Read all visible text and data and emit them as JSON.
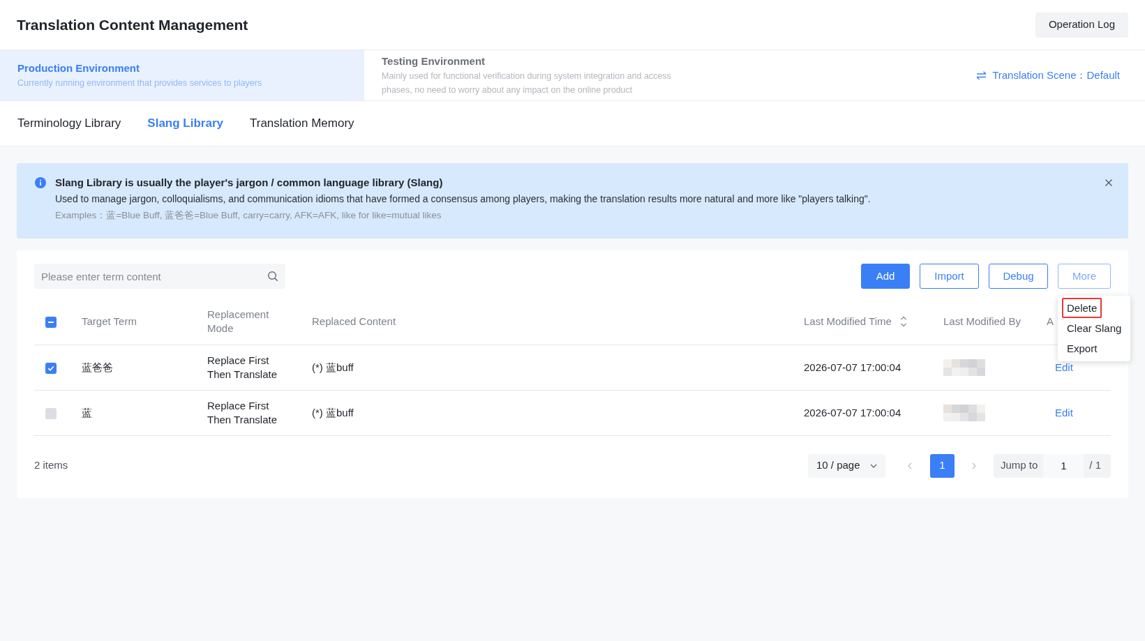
{
  "header": {
    "title": "Translation Content Management",
    "action_button": "Operation Log"
  },
  "environments": [
    {
      "title": "Production Environment",
      "description": "Currently running environment that provides services to players",
      "selected": true
    },
    {
      "title": "Testing Environment",
      "description": "Mainly used for functional verification during system integration and access phases, no need to worry about any impact on the online product",
      "selected": false
    }
  ],
  "translation_scene": "Translation Scene：Default",
  "tabs": [
    {
      "label": "Terminology Library",
      "selected": false
    },
    {
      "label": "Slang Library",
      "selected": true
    },
    {
      "label": "Translation Memory",
      "selected": false
    }
  ],
  "notice": {
    "title": "Slang Library is usually the player's jargon / common language library (Slang)",
    "body": "Used to manage jargon, colloquialisms, and communication idioms that have formed a consensus among players, making the translation results more natural and more like \"players talking\".",
    "examples": "Examples：蓝=Blue Buff, 蓝爸爸=Blue Buff, carry=carry, AFK=AFK, like for like=mutual likes"
  },
  "toolbar": {
    "search": {
      "placeholder": "Please enter term content"
    },
    "buttons": [
      {
        "label": "Add",
        "kind": "primary"
      },
      {
        "label": "Import",
        "kind": "outline"
      },
      {
        "label": "Debug",
        "kind": "outline"
      },
      {
        "label": "More",
        "kind": "dropdown",
        "expanded": true,
        "menu": [
          {
            "label": "Delete",
            "highlighted": true
          },
          {
            "label": "Clear Slang",
            "highlighted": false
          },
          {
            "label": "Export",
            "highlighted": false
          }
        ]
      }
    ]
  },
  "table": {
    "select_all": {
      "indeterminate": true
    },
    "columns": [
      {
        "label": "Target Term",
        "sortable": false
      },
      {
        "label": "Replacement Mode",
        "sortable": false
      },
      {
        "label": "Replaced Content",
        "sortable": false
      },
      {
        "label": "Last Modified Time",
        "sortable": true
      },
      {
        "label": "Last Modified By",
        "sortable": false
      },
      {
        "label": "A",
        "sortable": false
      }
    ],
    "rows": [
      {
        "selected": true,
        "target_term": "蓝爸爸",
        "replacement_mode": "Replace First Then Translate",
        "replaced_content": "(*) 蓝buff",
        "last_modified_time": "2026-07-07 17:00:04",
        "action": "Edit"
      },
      {
        "selected": false,
        "target_term": "蓝",
        "replacement_mode": "Replace First Then Translate",
        "replaced_content": "(*) 蓝buff",
        "last_modified_time": "2026-07-07 17:00:04",
        "action": "Edit"
      }
    ]
  },
  "pagination": {
    "total": "2 items",
    "page_size": "10 / page",
    "pages": [
      {
        "label": "1",
        "selected": true
      }
    ],
    "jump_label": "Jump to",
    "jump_value": "1",
    "page_total": "/ 1"
  }
}
